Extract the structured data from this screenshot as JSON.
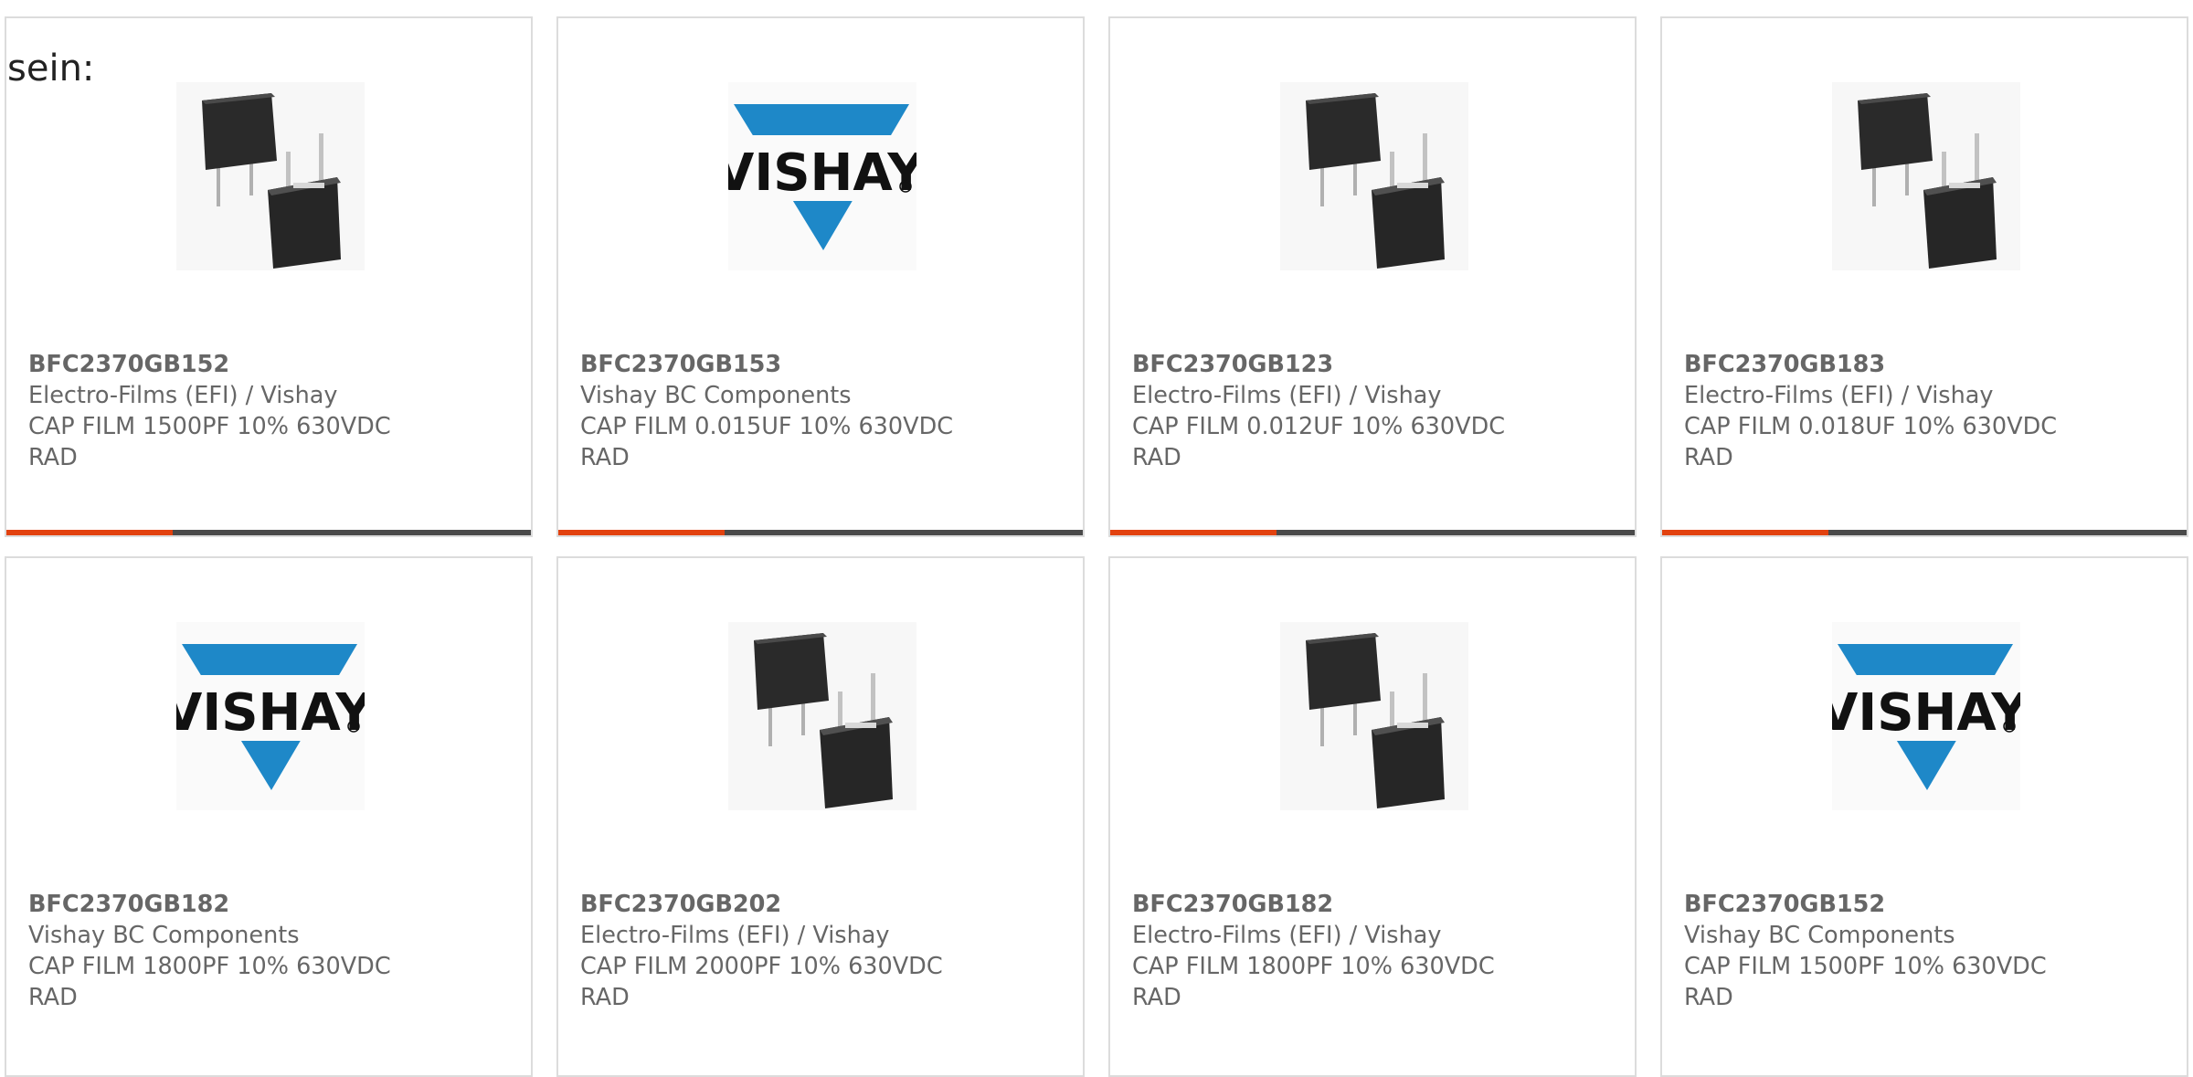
{
  "intro_text": "sein:",
  "colors": {
    "accent": "#e2420f",
    "bar": "#4a4a4a",
    "vishay_blue": "#1e88c8",
    "text": "#666666"
  },
  "products": [
    {
      "part": "BFC2370GB152",
      "manufacturer": "Electro-Films (EFI) / Vishay",
      "description": "CAP FILM 1500PF 10% 630VDC RAD",
      "image": "film-capacitor-photo"
    },
    {
      "part": "BFC2370GB153",
      "manufacturer": "Vishay BC Components",
      "description": "CAP FILM 0.015UF 10% 630VDC RAD",
      "image": "vishay-logo",
      "logo_text": "VISHAY"
    },
    {
      "part": "BFC2370GB123",
      "manufacturer": "Electro-Films (EFI) / Vishay",
      "description": "CAP FILM 0.012UF 10% 630VDC RAD",
      "image": "film-capacitor-photo"
    },
    {
      "part": "BFC2370GB183",
      "manufacturer": "Electro-Films (EFI) / Vishay",
      "description": "CAP FILM 0.018UF 10% 630VDC RAD",
      "image": "film-capacitor-photo"
    },
    {
      "part": "BFC2370GB182",
      "manufacturer": "Vishay BC Components",
      "description": "CAP FILM 1800PF 10% 630VDC RAD",
      "image": "vishay-logo",
      "logo_text": "VISHAY"
    },
    {
      "part": "BFC2370GB202",
      "manufacturer": "Electro-Films (EFI) / Vishay",
      "description": "CAP FILM 2000PF 10% 630VDC RAD",
      "image": "film-capacitor-photo"
    },
    {
      "part": "BFC2370GB182",
      "manufacturer": "Electro-Films (EFI) / Vishay",
      "description": "CAP FILM 1800PF 10% 630VDC RAD",
      "image": "film-capacitor-photo"
    },
    {
      "part": "BFC2370GB152",
      "manufacturer": "Vishay BC Components",
      "description": "CAP FILM 1500PF 10% 630VDC RAD",
      "image": "vishay-logo",
      "logo_text": "VISHAY"
    }
  ]
}
